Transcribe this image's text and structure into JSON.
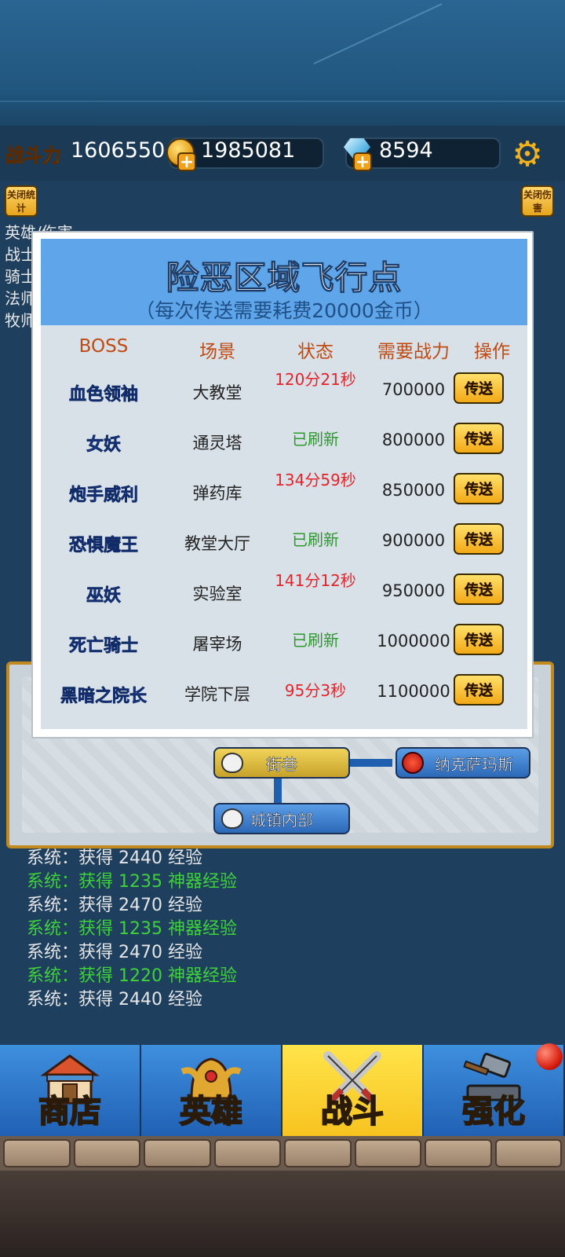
{
  "header": {
    "power_label": "战斗力",
    "power_value": "1606550",
    "gold_value": "1985081",
    "gem_value": "8594",
    "left_toggle": "关闭统计",
    "right_toggle": "关闭伤害"
  },
  "stats": [
    "英雄/伤害",
    "战士",
    "骑士",
    "法师",
    "牧师"
  ],
  "dialog": {
    "title": "险恶区域飞行点",
    "subtitle": "（每次传送需要耗费20000金币）",
    "columns": [
      "BOSS",
      "场景",
      "状态",
      "需要战力",
      "操作"
    ],
    "teleport_label": "传送",
    "rows": [
      {
        "boss": "血色领袖",
        "scene": "大教堂",
        "status": "120分21秒",
        "status_type": "timer",
        "power": "700000"
      },
      {
        "boss": "女妖",
        "scene": "通灵塔",
        "status": "已刷新",
        "status_type": "ready",
        "power": "800000"
      },
      {
        "boss": "炮手威利",
        "scene": "弹药库",
        "status": "134分59秒",
        "status_type": "timer",
        "power": "850000"
      },
      {
        "boss": "恐惧魔王",
        "scene": "教堂大厅",
        "status": "已刷新",
        "status_type": "ready",
        "power": "900000"
      },
      {
        "boss": "巫妖",
        "scene": "实验室",
        "status": "141分12秒",
        "status_type": "timer",
        "power": "950000"
      },
      {
        "boss": "死亡骑士",
        "scene": "屠宰场",
        "status": "已刷新",
        "status_type": "ready",
        "power": "1000000"
      },
      {
        "boss": "黑暗之院长",
        "scene": "学院下层",
        "status": "95分3秒",
        "status_type": "timer",
        "power": "1100000"
      }
    ]
  },
  "map": {
    "node_street": "街巷",
    "node_boss": "纳克萨玛斯",
    "node_town": "城镇内部"
  },
  "log": [
    {
      "text": "系统：获得 2440 经验",
      "color": "#e6e6e6"
    },
    {
      "text": "系统：获得 1235 神器经验",
      "color": "#3fd13a"
    },
    {
      "text": "系统：获得 2470 经验",
      "color": "#e6e6e6"
    },
    {
      "text": "系统：获得 1235 神器经验",
      "color": "#3fd13a"
    },
    {
      "text": "系统：获得 2470 经验",
      "color": "#e6e6e6"
    },
    {
      "text": "系统：获得 1220 神器经验",
      "color": "#3fd13a"
    },
    {
      "text": "系统：获得 2440 经验",
      "color": "#e6e6e6"
    }
  ],
  "nav": {
    "tabs": [
      {
        "label": "商店",
        "icon": "shop-icon",
        "active": false
      },
      {
        "label": "英雄",
        "icon": "helmet-icon",
        "active": false
      },
      {
        "label": "战斗",
        "icon": "crossed-swords-icon",
        "active": true
      },
      {
        "label": "强化",
        "icon": "hammer-icon",
        "active": false
      }
    ]
  },
  "colors": {
    "dialog_header": "#5ea6e9",
    "timer_red": "#e5232a",
    "ready_green": "#2a9a2a",
    "boss_blue": "#2a56b6",
    "gold": "#ffd23a"
  }
}
